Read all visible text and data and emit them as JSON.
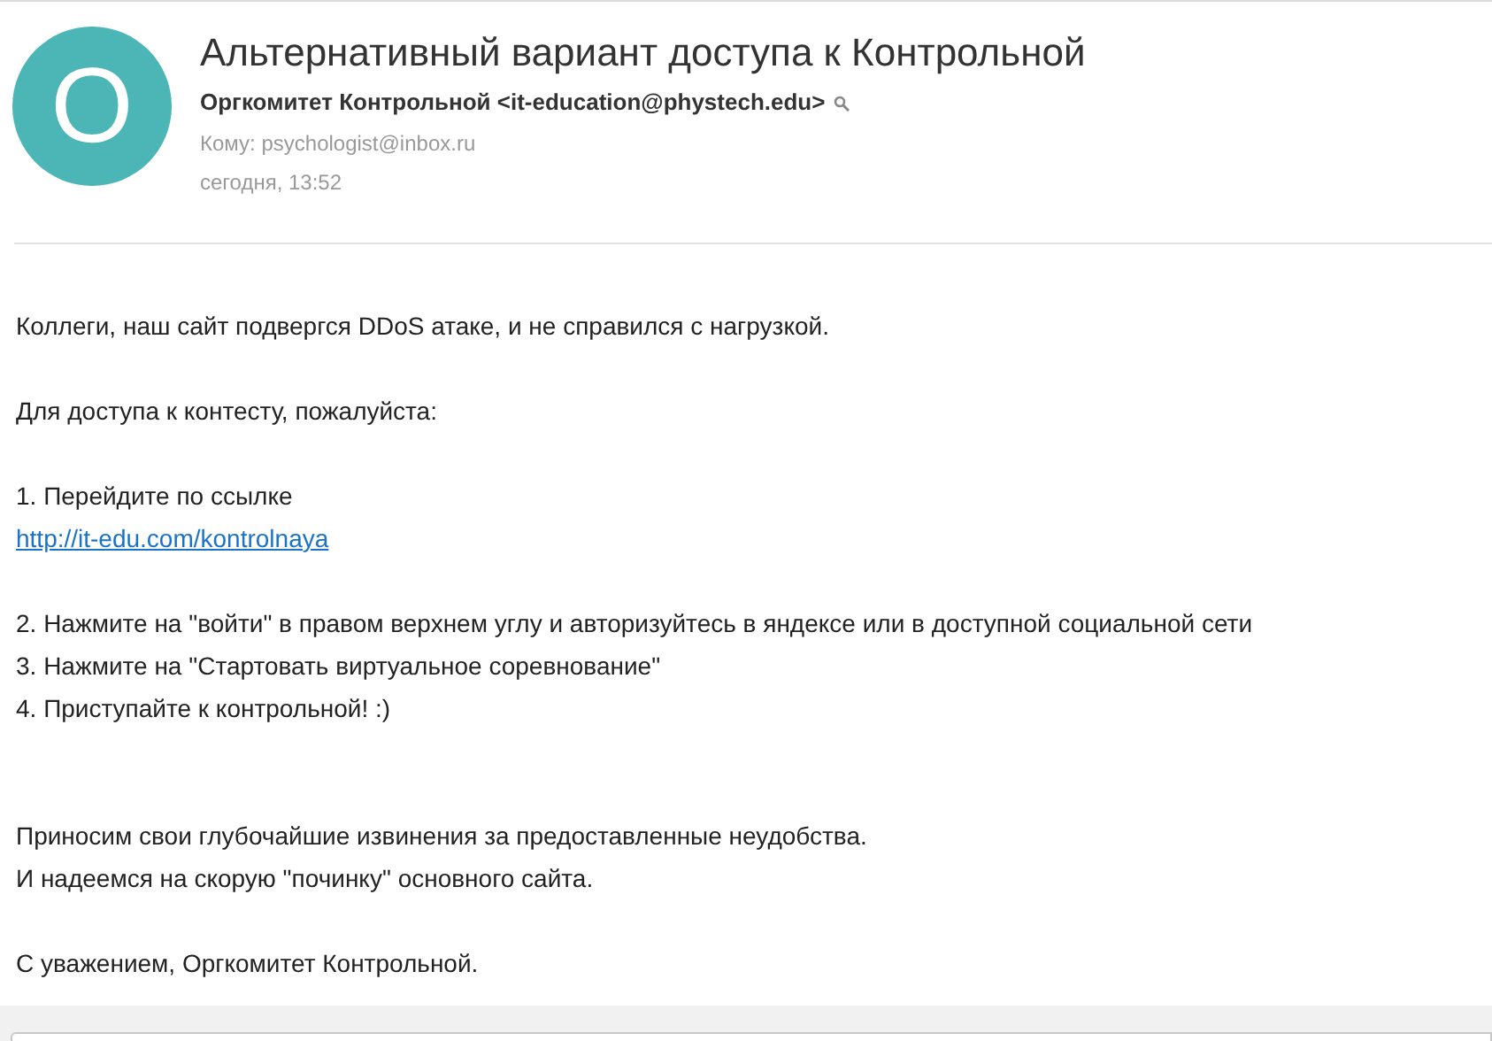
{
  "avatar": {
    "letter": "О"
  },
  "subject": "Альтернативный вариант доступа к Контрольной",
  "sender": "Оргкомитет Контрольной <it-education@phystech.edu>",
  "recipient": "Кому: psychologist@inbox.ru",
  "date": "сегодня, 13:52",
  "body": [
    [
      {
        "kind": "text",
        "text": "Коллеги, наш сайт подвергся DDoS атаке, и не справился с нагрузкой."
      }
    ],
    [
      {
        "kind": "text",
        "text": "Для доступа к контесту, пожалуйста:"
      }
    ],
    [
      {
        "kind": "text",
        "text": "1. Перейдите по ссылке"
      },
      {
        "kind": "link",
        "text": "http://it-edu.com/kontrolnaya"
      }
    ],
    [
      {
        "kind": "text",
        "text": "2. Нажмите на \"войти\" в правом верхнем углу и авторизуйтесь в яндексе или в доступной социальной сети"
      },
      {
        "kind": "text",
        "text": "3. Нажмите на \"Стартовать виртуальное соревнование\""
      },
      {
        "kind": "text",
        "text": "4. Приступайте к контрольной! :)"
      }
    ],
    [
      {
        "kind": "text",
        "text": "Приносим свои глубочайшие извинения за предоставленные неудобства."
      },
      {
        "kind": "text",
        "text": "И надеемся на скорую \"починку\" основного сайта."
      }
    ],
    [
      {
        "kind": "text",
        "text": "С уважением, Оргкомитет Контрольной."
      }
    ]
  ]
}
